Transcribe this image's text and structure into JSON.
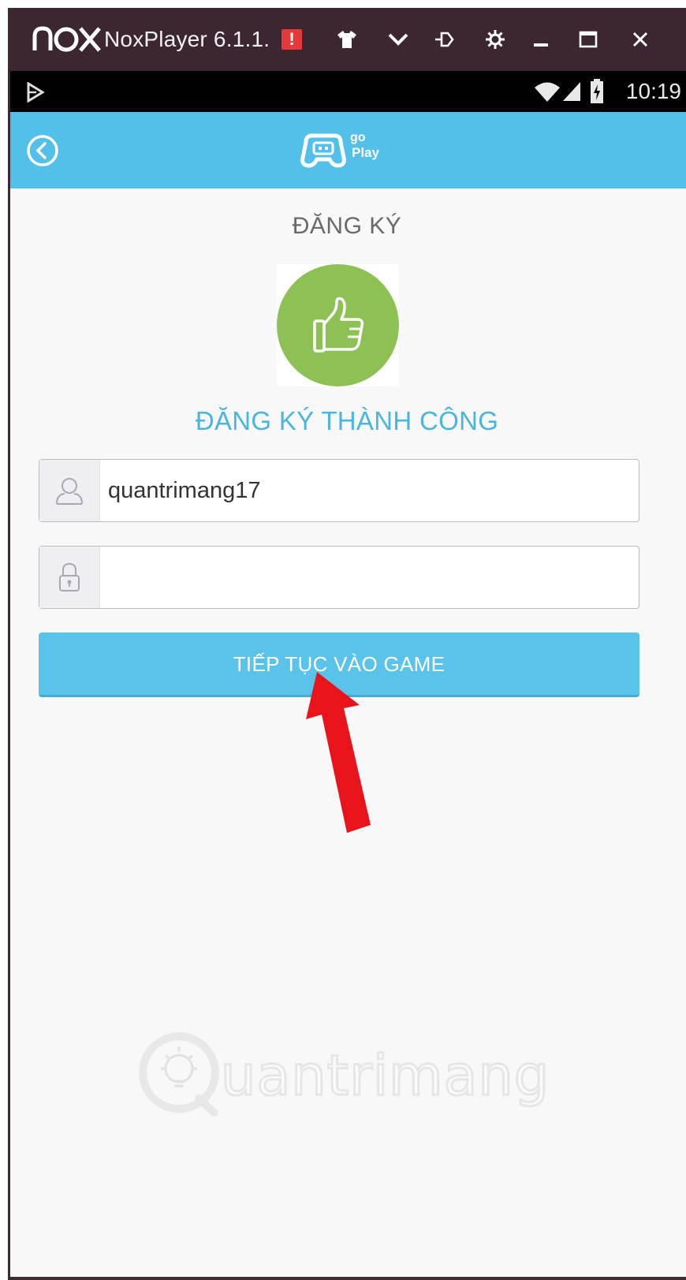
{
  "window": {
    "title": "NoxPlayer 6.1.1.",
    "brand": "nox",
    "toolbar_icons": [
      "alert-icon",
      "theme-icon",
      "chevron-down-icon",
      "pin-icon",
      "gear-icon",
      "minimize-icon",
      "maximize-icon",
      "close-icon"
    ]
  },
  "statusbar": {
    "time": "10:19",
    "icons": [
      "play-store-icon",
      "wifi-icon",
      "signal-icon",
      "battery-icon"
    ]
  },
  "appbar": {
    "logo_text_top": "go",
    "logo_text_bottom": "Play",
    "back_icon": "back-icon"
  },
  "content": {
    "heading": "ĐĂNG KÝ",
    "success_icon": "thumbs-up-icon",
    "success_text": "ĐĂNG KÝ THÀNH CÔNG",
    "username_value": "quantrimang17",
    "password_value": "",
    "continue_label": "TIẾP TỤC VÀO GAME"
  },
  "watermark": {
    "text": "uantrimang"
  },
  "colors": {
    "titlebar": "#3b2631",
    "appbar": "#52c0e8",
    "button": "#5ac3e9",
    "success_text": "#49b6dc",
    "thumb_circle": "#8dc153",
    "arrow": "#e8131b"
  }
}
